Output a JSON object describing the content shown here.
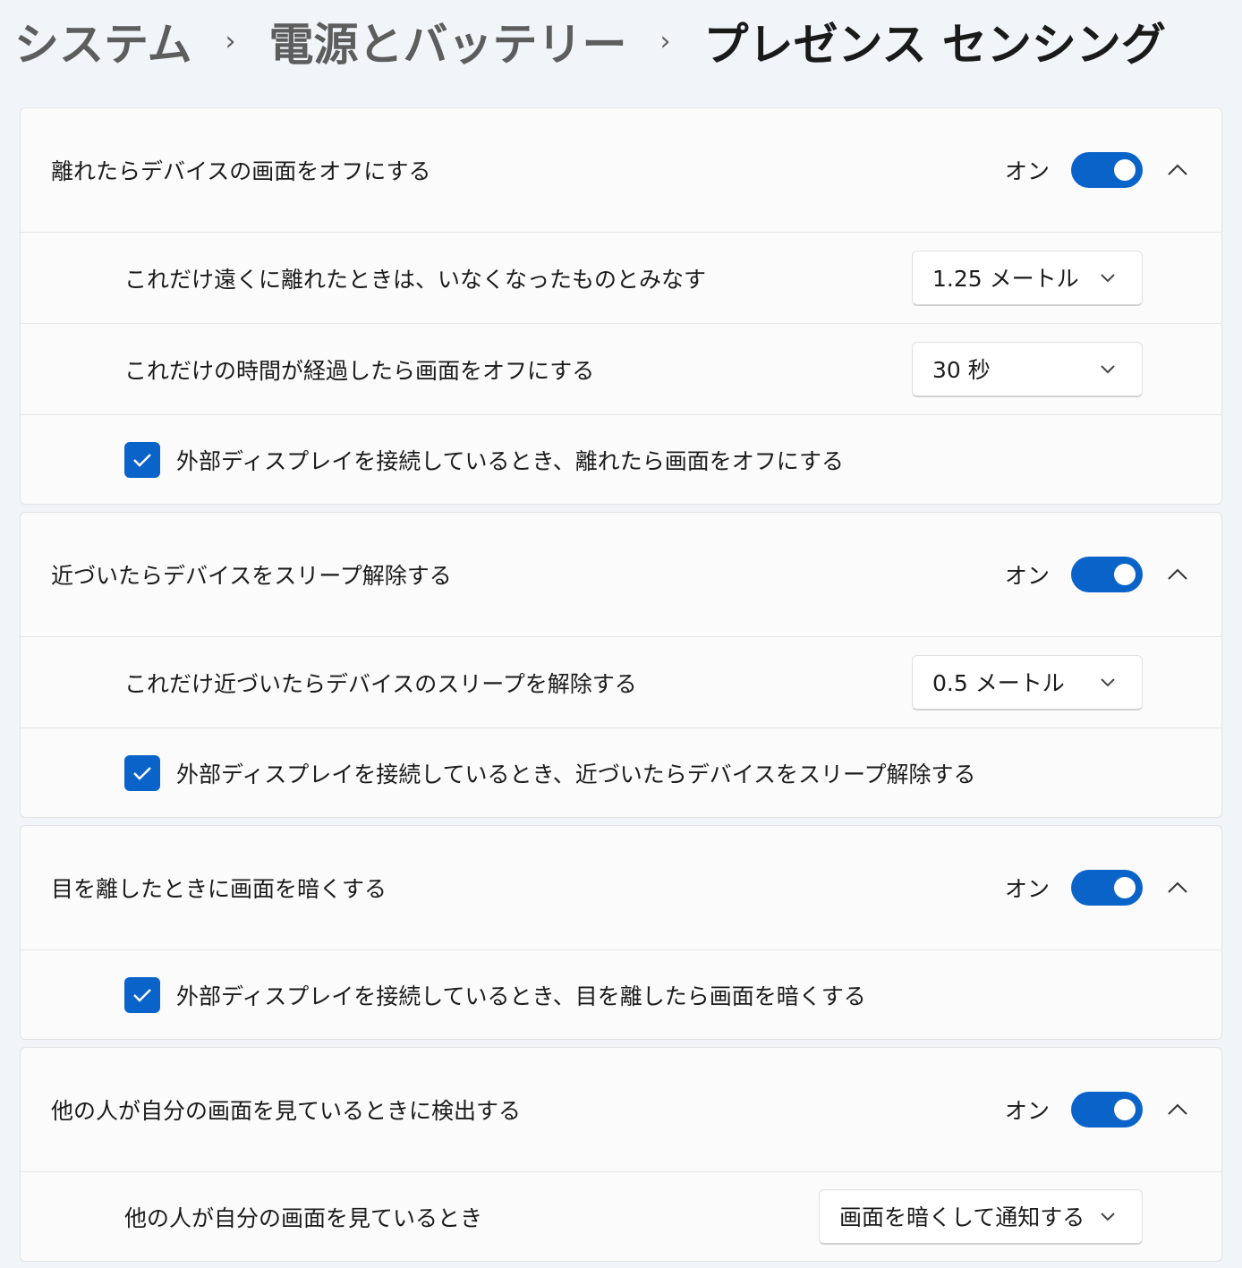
{
  "breadcrumb": {
    "items": [
      "システム",
      "電源とバッテリー",
      "プレゼンス センシング"
    ],
    "separator": "›"
  },
  "accent_color": "#0a63c9",
  "sections": {
    "away": {
      "title": "離れたらデバイスの画面をオフにする",
      "toggle_label": "オン",
      "toggle_on": true,
      "distance_label": "これだけ遠くに離れたときは、いなくなったものとみなす",
      "distance_value": "1.25 メートル",
      "time_label": "これだけの時間が経過したら画面をオフにする",
      "time_value": "30 秒",
      "external_label": "外部ディスプレイを接続しているとき、離れたら画面をオフにする",
      "external_checked": true
    },
    "approach": {
      "title": "近づいたらデバイスをスリープ解除する",
      "toggle_label": "オン",
      "toggle_on": true,
      "distance_label": "これだけ近づいたらデバイスのスリープを解除する",
      "distance_value": "0.5 メートル",
      "external_label": "外部ディスプレイを接続しているとき、近づいたらデバイスをスリープ解除する",
      "external_checked": true
    },
    "dim": {
      "title": "目を離したときに画面を暗くする",
      "toggle_label": "オン",
      "toggle_on": true,
      "external_label": "外部ディスプレイを接続しているとき、目を離したら画面を暗くする",
      "external_checked": true
    },
    "onlooker": {
      "title": "他の人が自分の画面を見ているときに検出する",
      "toggle_label": "オン",
      "toggle_on": true,
      "action_label": "他の人が自分の画面を見ているとき",
      "action_value": "画面を暗くして通知する"
    }
  },
  "icons": {
    "collapse": "chevron-up-icon",
    "dropdown": "chevron-down-icon",
    "check": "checkmark-icon",
    "separator": "chevron-right-icon"
  }
}
